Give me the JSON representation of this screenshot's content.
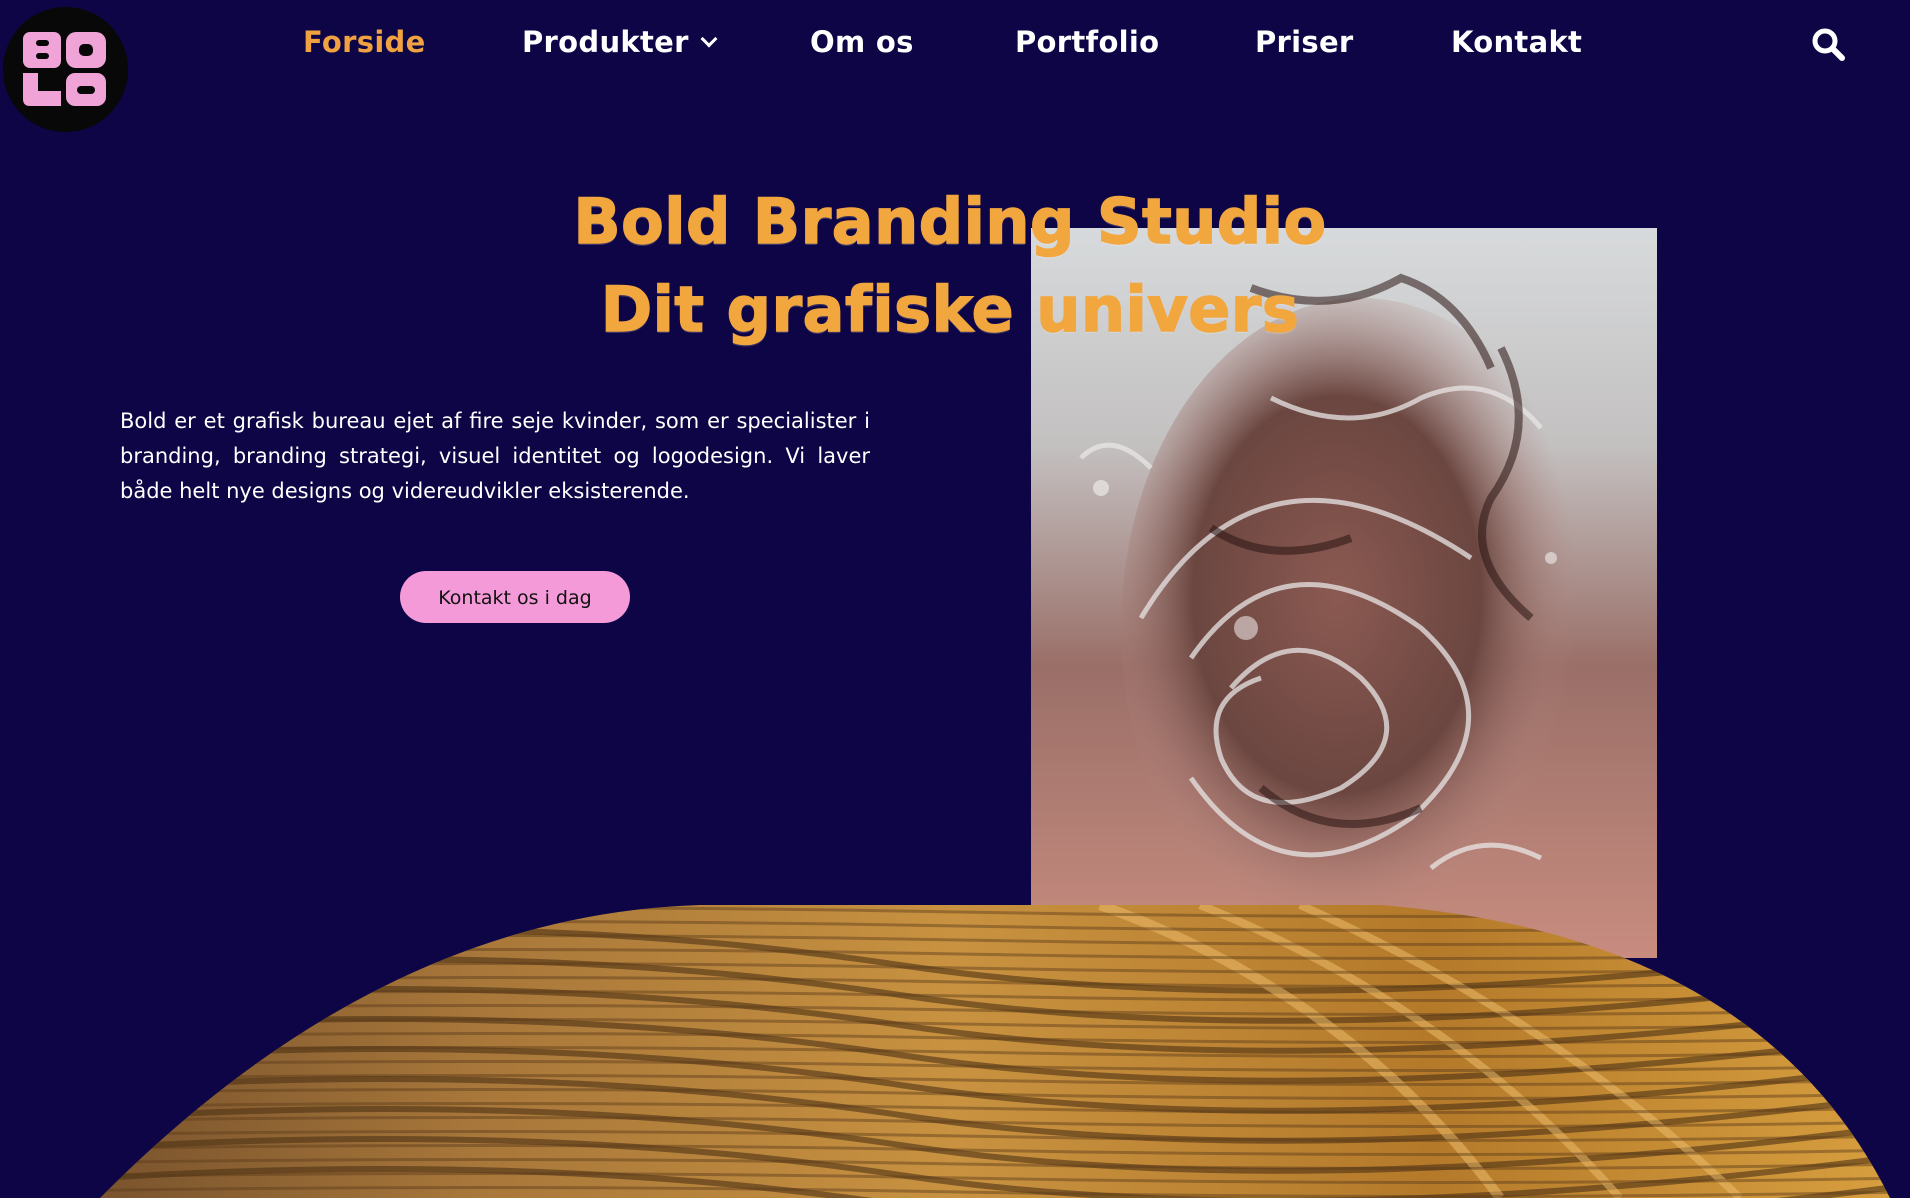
{
  "logo": {
    "alt": "BOLD",
    "icon": "bold-logo-icon",
    "colors": {
      "background": "#080808",
      "letters": "#f0a3d6"
    }
  },
  "nav": {
    "items": [
      {
        "label": "Forside",
        "active": true
      },
      {
        "label": "Produkter",
        "has_dropdown": true
      },
      {
        "label": "Om os"
      },
      {
        "label": "Portfolio"
      },
      {
        "label": "Priser"
      },
      {
        "label": "Kontakt"
      }
    ],
    "search_icon": "search-icon"
  },
  "hero": {
    "title_line1": "Bold Branding Studio",
    "title_line2": "Dit grafiske univers",
    "intro": "Bold er et grafisk bureau ejet af fire seje kvinder, som er specialister i branding, branding strategi, visuel identitet og logodesign. Vi laver både helt nye designs og videreudvikler eksisterende.",
    "cta_label": "Kontakt os i dag",
    "photo_alt": "Kvinde under vandoverfladen"
  },
  "colors": {
    "page_background": "#0d0545",
    "accent_orange": "#f2a63e",
    "cta_pink": "#f59ad8",
    "nav_text": "#ffffff",
    "gold": "#c58a2e"
  }
}
